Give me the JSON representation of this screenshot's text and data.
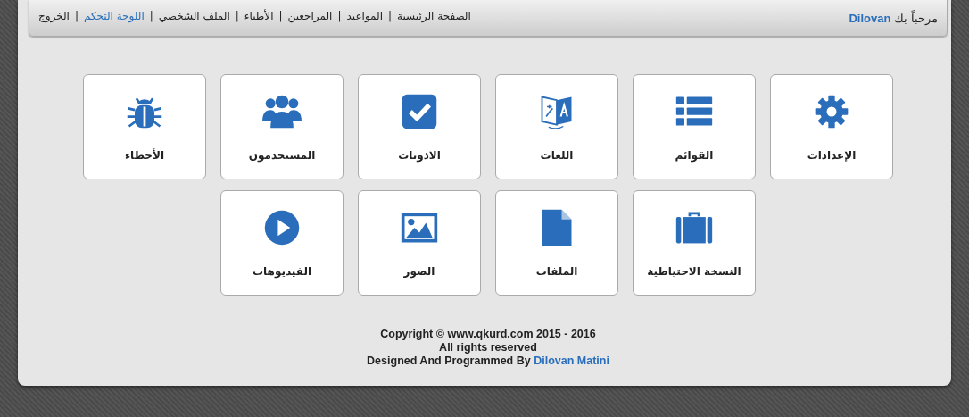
{
  "navbar": {
    "greeting": "مرحباً بك",
    "user": "Dilovan",
    "links": [
      {
        "label": "الصفحة الرئيسية",
        "selected": false
      },
      {
        "label": "المواعيد",
        "selected": false
      },
      {
        "label": "المراجعين",
        "selected": false
      },
      {
        "label": "الأطباء",
        "selected": false
      },
      {
        "label": "الملف الشخصي",
        "selected": false
      },
      {
        "label": "اللوحة التحكم",
        "selected": true
      },
      {
        "label": "الخروج",
        "selected": false
      }
    ],
    "separator": "|"
  },
  "tiles": [
    {
      "label": "الإعدادات"
    },
    {
      "label": "القوائم"
    },
    {
      "label": "اللغات"
    },
    {
      "label": "الاذونات"
    },
    {
      "label": "المستخدمون"
    },
    {
      "label": "الأخطاء"
    },
    {
      "label": "النسخة الاحتياطية"
    },
    {
      "label": "الملفات"
    },
    {
      "label": "الصور"
    },
    {
      "label": "الفيديوهات"
    }
  ],
  "footer": {
    "copyright": "Copyright © www.qkurd.com 2015 - 2016",
    "rights": "All rights reserved",
    "credit": "Designed And Programmed By",
    "author": "Dilovan Matini"
  }
}
